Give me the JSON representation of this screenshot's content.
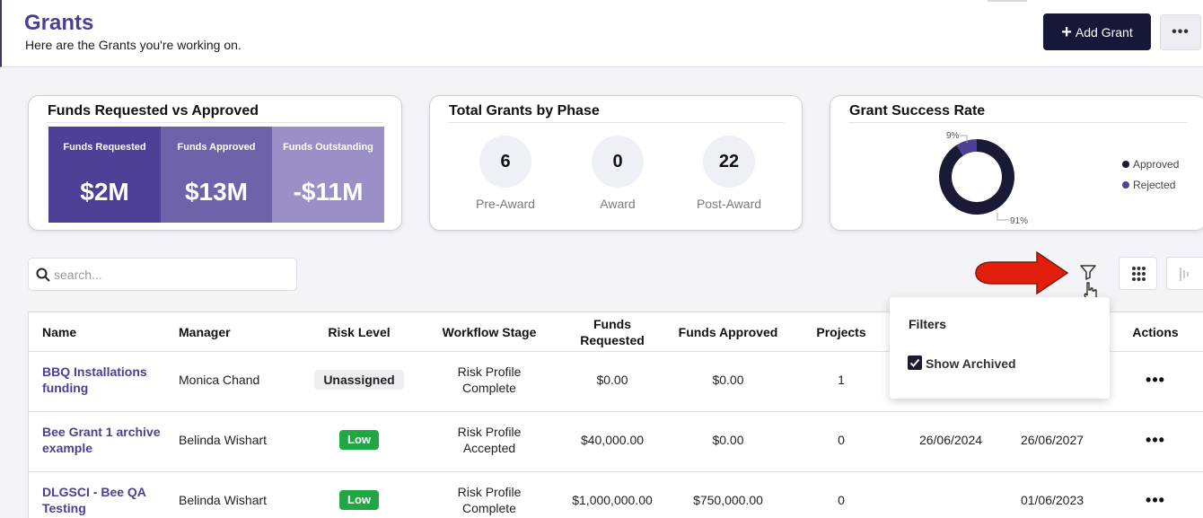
{
  "header": {
    "title": "Grants",
    "subtitle": "Here are the Grants you're working on.",
    "add_button_label": "Add Grant",
    "more_label": "•••"
  },
  "funds_card": {
    "title": "Funds Requested vs Approved",
    "boxes": [
      {
        "label": "Funds Requested",
        "value": "$2M",
        "color": "#4e3f97"
      },
      {
        "label": "Funds Approved",
        "value": "$13M",
        "color": "#6e62ab"
      },
      {
        "label": "Funds Outstanding",
        "value": "-$11M",
        "color": "#9a90c7"
      }
    ]
  },
  "phase_card": {
    "title": "Total Grants by Phase",
    "phases": [
      {
        "count": "6",
        "label": "Pre-Award"
      },
      {
        "count": "0",
        "label": "Award"
      },
      {
        "count": "22",
        "label": "Post-Award"
      }
    ]
  },
  "success_card": {
    "title": "Grant Success Rate",
    "chart_data": {
      "type": "pie",
      "categories": [
        "Approved",
        "Rejected"
      ],
      "values": [
        91,
        9
      ],
      "data_labels": [
        "91%",
        "9%"
      ],
      "colors": [
        "#1a1a36",
        "#4e3f97"
      ],
      "legend": "right"
    }
  },
  "search": {
    "placeholder": "search..."
  },
  "filters": {
    "title": "Filters",
    "show_archived_label": "Show Archived",
    "show_archived_checked": true
  },
  "table": {
    "columns": [
      "Name",
      "Manager",
      "Risk Level",
      "Workflow Stage",
      "Funds Requested",
      "Funds Approved",
      "Projects",
      "Actions"
    ],
    "rows": [
      {
        "name": "BBQ Installations funding",
        "manager": "Monica Chand",
        "risk": "Unassigned",
        "stage": "Risk Profile Complete",
        "requested": "$0.00",
        "approved": "$0.00",
        "projects": "1",
        "start": "",
        "end": "",
        "actions": "•••"
      },
      {
        "name": "Bee Grant 1 archive example",
        "manager": "Belinda Wishart",
        "risk": "Low",
        "stage": "Risk Profile Accepted",
        "requested": "$40,000.00",
        "approved": "$0.00",
        "projects": "0",
        "start": "26/06/2024",
        "end": "26/06/2027",
        "actions": "•••"
      },
      {
        "name": "DLGSCI - Bee QA Testing",
        "manager": "Belinda Wishart",
        "risk": "Low",
        "stage": "Risk Profile Complete",
        "requested": "$1,000,000.00",
        "approved": "$750,000.00",
        "projects": "0",
        "start": "",
        "end": "01/06/2023",
        "actions": "•••"
      }
    ]
  }
}
